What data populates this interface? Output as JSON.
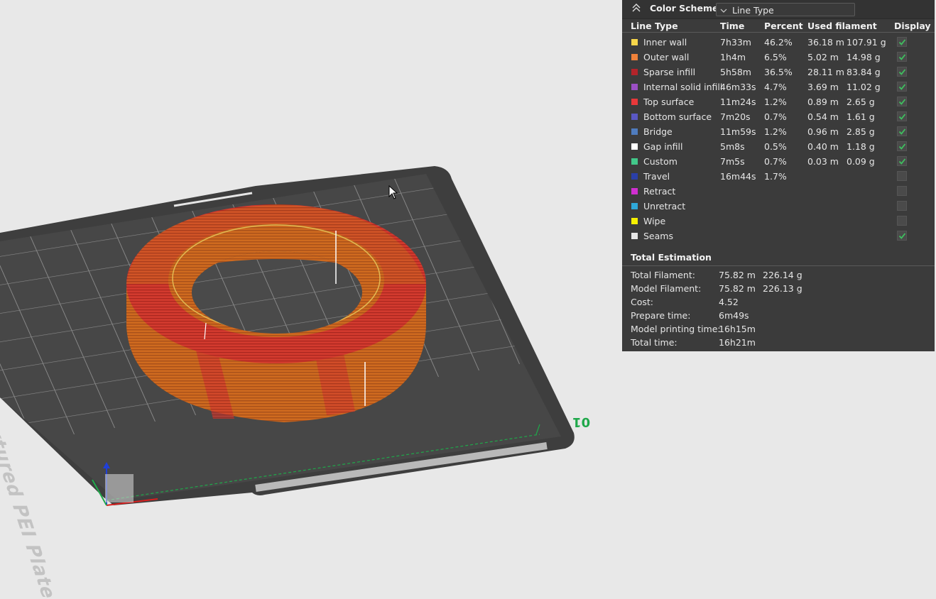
{
  "viewport": {
    "plate_label": "Bambu Textured PEI Plate",
    "plate_number": "01"
  },
  "color_scheme": {
    "title": "Color Scheme",
    "selected": "Line Type"
  },
  "table": {
    "headers": [
      "Line Type",
      "Time",
      "Percent",
      "Used filament",
      "Display"
    ],
    "rows": [
      {
        "name": "Inner wall",
        "color": "#f7d64a",
        "time": "7h33m",
        "percent": "46.2%",
        "length": "36.18 m",
        "weight": "107.91 g",
        "display": true
      },
      {
        "name": "Outer wall",
        "color": "#f0823a",
        "time": "1h4m",
        "percent": "6.5%",
        "length": "5.02 m",
        "weight": "14.98 g",
        "display": true
      },
      {
        "name": "Sparse infill",
        "color": "#b3242a",
        "time": "5h58m",
        "percent": "36.5%",
        "length": "28.11 m",
        "weight": "83.84 g",
        "display": true
      },
      {
        "name": "Internal solid infill",
        "color": "#9b4fc4",
        "time": "46m33s",
        "percent": "4.7%",
        "length": "3.69 m",
        "weight": "11.02 g",
        "display": true
      },
      {
        "name": "Top surface",
        "color": "#e8383a",
        "time": "11m24s",
        "percent": "1.2%",
        "length": "0.89 m",
        "weight": "2.65 g",
        "display": true
      },
      {
        "name": "Bottom surface",
        "color": "#5a58c4",
        "time": "7m20s",
        "percent": "0.7%",
        "length": "0.54 m",
        "weight": "1.61 g",
        "display": true
      },
      {
        "name": "Bridge",
        "color": "#4f7cbe",
        "time": "11m59s",
        "percent": "1.2%",
        "length": "0.96 m",
        "weight": "2.85 g",
        "display": true
      },
      {
        "name": "Gap infill",
        "color": "#ffffff",
        "time": "5m8s",
        "percent": "0.5%",
        "length": "0.40 m",
        "weight": "1.18 g",
        "display": true
      },
      {
        "name": "Custom",
        "color": "#42c88a",
        "time": "7m5s",
        "percent": "0.7%",
        "length": "0.03 m",
        "weight": "0.09 g",
        "display": true
      },
      {
        "name": "Travel",
        "color": "#2a3fa8",
        "time": "16m44s",
        "percent": "1.7%",
        "length": "",
        "weight": "",
        "display": false
      },
      {
        "name": "Retract",
        "color": "#d02fd0",
        "time": "",
        "percent": "",
        "length": "",
        "weight": "",
        "display": false
      },
      {
        "name": "Unretract",
        "color": "#2fa8d8",
        "time": "",
        "percent": "",
        "length": "",
        "weight": "",
        "display": false
      },
      {
        "name": "Wipe",
        "color": "#f5f000",
        "time": "",
        "percent": "",
        "length": "",
        "weight": "",
        "display": false
      },
      {
        "name": "Seams",
        "color": "#e6e6e6",
        "time": "",
        "percent": "",
        "length": "",
        "weight": "",
        "display": true
      }
    ]
  },
  "totals": {
    "title": "Total Estimation",
    "rows": [
      {
        "label": "Total Filament:",
        "v1": "75.82 m",
        "v2": "226.14 g"
      },
      {
        "label": "Model Filament:",
        "v1": "75.82 m",
        "v2": "226.13 g"
      },
      {
        "label": "Cost:",
        "v1": "4.52",
        "v2": ""
      },
      {
        "label": "Prepare time:",
        "v1": "6m49s",
        "v2": ""
      },
      {
        "label": "Model printing time:",
        "v1": "16h15m",
        "v2": ""
      },
      {
        "label": "Total time:",
        "v1": "16h21m",
        "v2": ""
      }
    ]
  },
  "colors": {
    "panel_bg": "#3b3b3b",
    "checkbox_check": "#3fbf5f",
    "model_orange": "#d2691e",
    "model_red": "#c8342e",
    "plate_dark": "#3e3e3e"
  }
}
